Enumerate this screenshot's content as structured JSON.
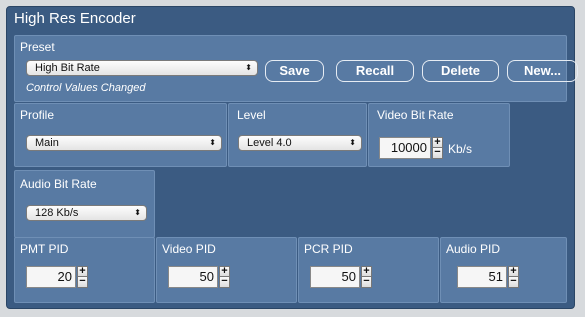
{
  "window": {
    "title": "High Res Encoder"
  },
  "preset": {
    "label": "Preset",
    "selected": "High Bit Rate",
    "status": "Control Values Changed",
    "buttons": {
      "save": "Save",
      "recall": "Recall",
      "delete": "Delete",
      "new": "New..."
    }
  },
  "profile": {
    "label": "Profile",
    "selected": "Main"
  },
  "level": {
    "label": "Level",
    "selected": "Level 4.0"
  },
  "video_bit_rate": {
    "label": "Video Bit Rate",
    "value": "10000",
    "unit": "Kb/s"
  },
  "audio_bit_rate": {
    "label": "Audio Bit Rate",
    "selected": "128 Kb/s"
  },
  "pids": {
    "pmt": {
      "label": "PMT PID",
      "value": "20"
    },
    "video": {
      "label": "Video PID",
      "value": "50"
    },
    "pcr": {
      "label": "PCR PID",
      "value": "50"
    },
    "audio": {
      "label": "Audio PID",
      "value": "51"
    }
  },
  "glyphs": {
    "updown": "⬍",
    "plus": "+",
    "minus": "−"
  }
}
